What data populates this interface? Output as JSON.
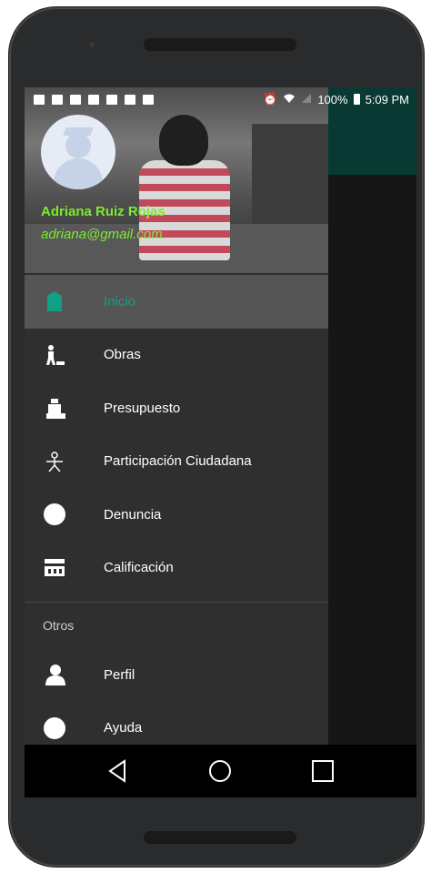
{
  "status_bar": {
    "battery": "100%",
    "time": "5:09 PM"
  },
  "drawer_header": {
    "user_name": "Adriana Ruiz Rojas",
    "user_email": "adriana@gmail.com"
  },
  "menu": {
    "items": [
      {
        "label": "Inicio",
        "icon": "home-icon",
        "active": true
      },
      {
        "label": "Obras",
        "icon": "construction-worker-icon",
        "active": false
      },
      {
        "label": "Presupuesto",
        "icon": "money-bag-icon",
        "active": false
      },
      {
        "label": "Participación Ciudadana",
        "icon": "people-group-icon",
        "active": false
      },
      {
        "label": "Denuncia",
        "icon": "report-icon",
        "active": false
      },
      {
        "label": "Calificación",
        "icon": "rating-icon",
        "active": false
      }
    ],
    "section_label": "Otros",
    "other_items": [
      {
        "label": "Perfil",
        "icon": "profile-icon"
      },
      {
        "label": "Ayuda",
        "icon": "help-icon"
      }
    ]
  },
  "colors": {
    "accent": "#0fa086",
    "header_text": "#7dea2f",
    "drawer_bg": "#2f2f2f",
    "active_bg": "#555555"
  }
}
